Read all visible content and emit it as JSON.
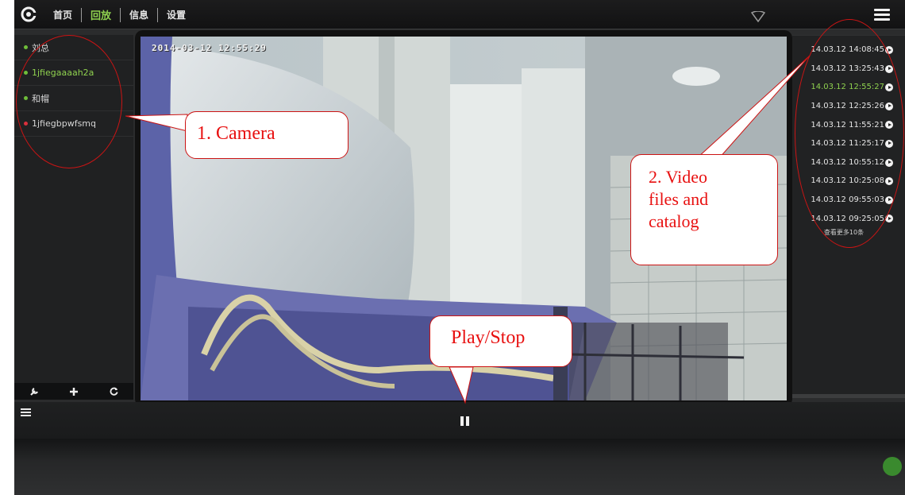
{
  "nav": {
    "items": [
      {
        "label": "首页",
        "active": false
      },
      {
        "label": "回放",
        "active": true
      },
      {
        "label": "信息",
        "active": false
      },
      {
        "label": "设置",
        "active": false
      }
    ]
  },
  "cameras": [
    {
      "name": "刘总",
      "status": "online",
      "selected": false
    },
    {
      "name": "1jfiegaaaah2a",
      "status": "online",
      "selected": true
    },
    {
      "name": "和帽",
      "status": "online",
      "selected": false
    },
    {
      "name": "1jfiegbpwfsmq",
      "status": "offline",
      "selected": false
    }
  ],
  "tools": [
    "wrench-icon",
    "plus-icon",
    "refresh-icon"
  ],
  "video": {
    "osd_timestamp": "2014-03-12 12:55:29"
  },
  "recordings": {
    "items": [
      {
        "time": "14.03.12 14:08:45",
        "current": false
      },
      {
        "time": "14.03.12 13:25:43",
        "current": false
      },
      {
        "time": "14.03.12 12:55:27",
        "current": true
      },
      {
        "time": "14.03.12 12:25:26",
        "current": false
      },
      {
        "time": "14.03.12 11:55:21",
        "current": false
      },
      {
        "time": "14.03.12 11:25:17",
        "current": false
      },
      {
        "time": "14.03.12 10:55:12",
        "current": false
      },
      {
        "time": "14.03.12 10:25:08",
        "current": false
      },
      {
        "time": "14.03.12 09:55:03",
        "current": false
      },
      {
        "time": "14.03.12 09:25:05",
        "current": false
      }
    ],
    "more_label": "查看更多10条"
  },
  "annotations": {
    "camera": "1. Camera",
    "video_line1": "2. Video",
    "video_line2": "files and",
    "video_line3": "catalog",
    "play_stop": "Play/Stop"
  },
  "colors": {
    "accent_green": "#8fd14f",
    "annotation_red": "#cc1414",
    "offline_red": "#d9303c"
  }
}
